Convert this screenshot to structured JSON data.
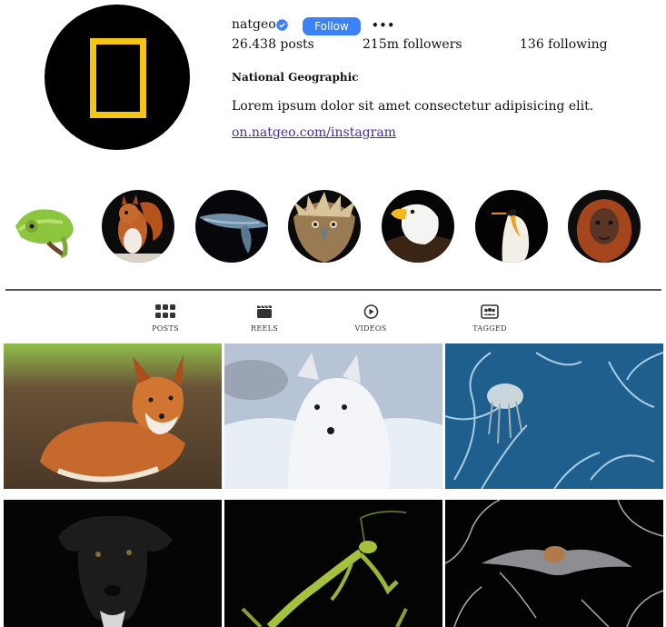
{
  "profile": {
    "username": "natgeo",
    "follow_label": "Follow",
    "more_label": "•••",
    "stats": {
      "posts": "26.438 posts",
      "followers": "215m followers",
      "following": "136 following"
    },
    "bio": {
      "name": "National Geographic",
      "text": "Lorem ipsum dolor sit amet consectetur adipisicing elit.",
      "link": "on.natgeo.com/instagram"
    }
  },
  "highlights": [
    {
      "subject": "chameleon"
    },
    {
      "subject": "red squirrel"
    },
    {
      "subject": "humpback whale"
    },
    {
      "subject": "philippine eagle"
    },
    {
      "subject": "bald eagle"
    },
    {
      "subject": "king penguin"
    },
    {
      "subject": "orangutan"
    }
  ],
  "tabs": [
    {
      "label": "POSTS",
      "icon": "grid-icon"
    },
    {
      "label": "REELS",
      "icon": "clapperboard-icon"
    },
    {
      "label": "VIDEOS",
      "icon": "play-icon"
    },
    {
      "label": "TAGGED",
      "icon": "tagged-icon"
    }
  ],
  "posts": [
    {
      "subject": "red fox"
    },
    {
      "subject": "arctic fox"
    },
    {
      "subject": "jellyfish in blue coral"
    },
    {
      "subject": "black dog"
    },
    {
      "subject": "praying mantis"
    },
    {
      "subject": "bat"
    }
  ],
  "colors": {
    "follow_button": "#3c82f6",
    "verified_badge": "#3c82f6",
    "logo_frame": "#f5c416",
    "link": "#4b2aa0"
  }
}
